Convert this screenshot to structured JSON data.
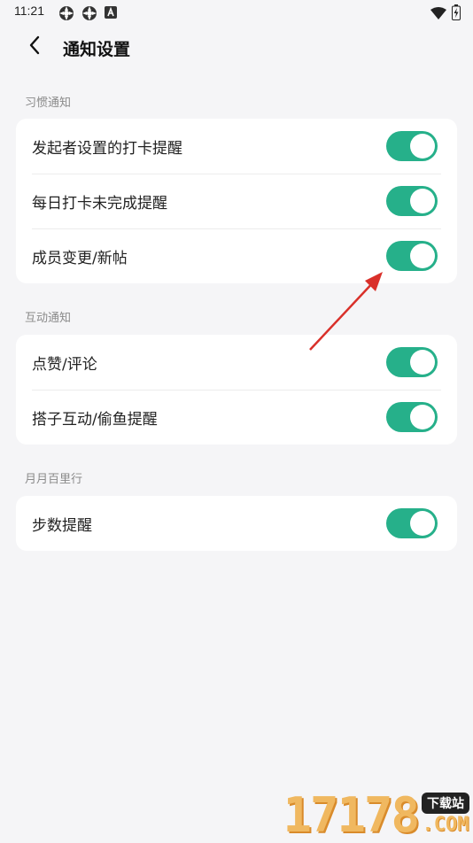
{
  "status_bar": {
    "time": "11:21",
    "left_icons": [
      "app-notification-icon",
      "app-notification-icon",
      "a-letter-icon"
    ],
    "right_icons": [
      "wifi-icon",
      "battery-charging-icon"
    ]
  },
  "header": {
    "title": "通知设置"
  },
  "sections": [
    {
      "label": "习惯通知",
      "rows": [
        {
          "label": "发起者设置的打卡提醒",
          "enabled": true
        },
        {
          "label": "每日打卡未完成提醒",
          "enabled": true
        },
        {
          "label": "成员变更/新帖",
          "enabled": true
        }
      ]
    },
    {
      "label": "互动通知",
      "rows": [
        {
          "label": "点赞/评论",
          "enabled": true
        },
        {
          "label": "搭子互动/偷鱼提醒",
          "enabled": true
        }
      ]
    },
    {
      "label": "月月百里行",
      "rows": [
        {
          "label": "步数提醒",
          "enabled": true
        }
      ]
    }
  ],
  "colors": {
    "toggle_on": "#26b08a",
    "background": "#f5f5f7",
    "annotation_arrow": "#d9302a"
  },
  "watermark": {
    "number": "17178",
    "tag": "下载站",
    "domain": ".COM"
  }
}
